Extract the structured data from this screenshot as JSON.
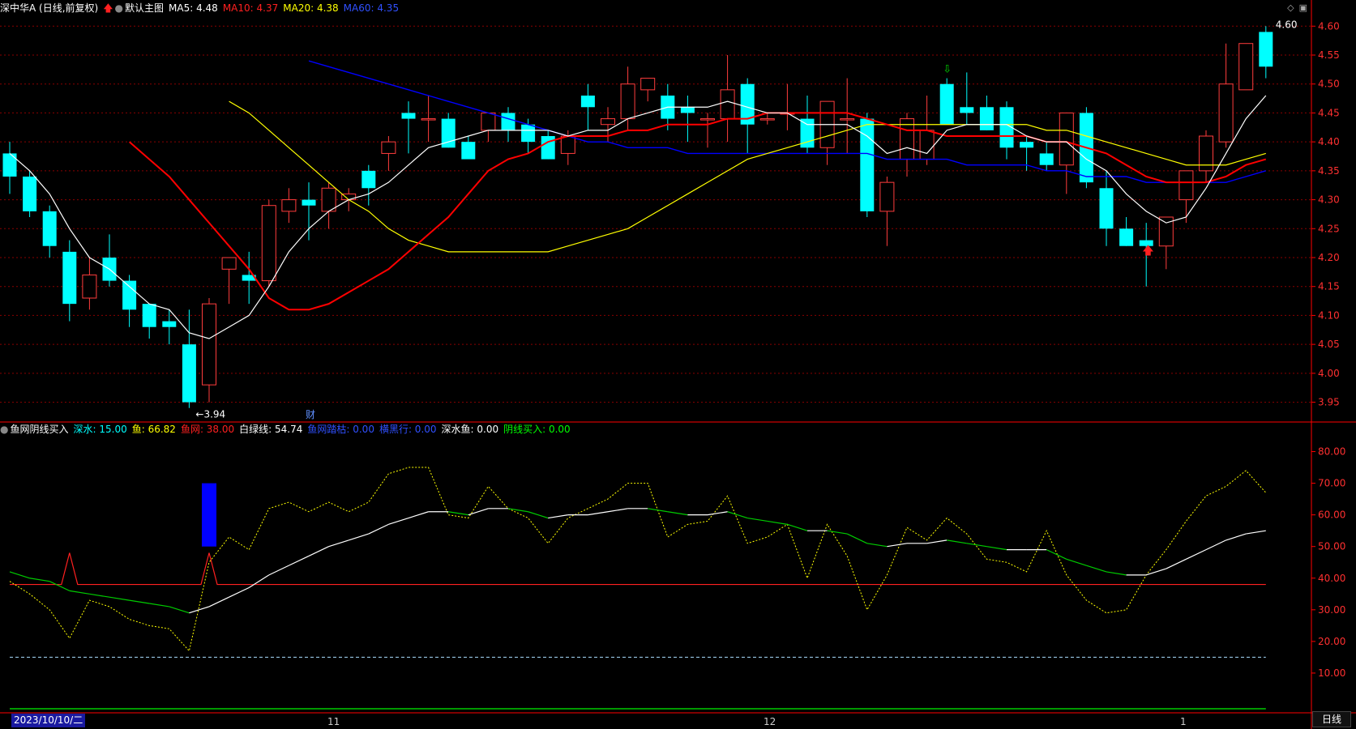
{
  "main_header": {
    "stock": "深中华A (日线,前复权)",
    "template": "默认主图",
    "ma5": "MA5: 4.48",
    "ma10": "MA10: 4.37",
    "ma20": "MA20: 4.38",
    "ma60": "MA60: 4.35"
  },
  "sub_header": {
    "name": "鱼网阴线买入",
    "deep_water": "深水: 15.00",
    "fish": "鱼: 66.82",
    "net": "鱼网: 38.00",
    "white_line": "白绿线: 54.74",
    "net_fish": "鱼网踏枯: 0.00",
    "mark_line": "横黑行: 0.00",
    "deep_fish": "深水鱼: 0.00",
    "yin_buy": "阴线买入: 0.00"
  },
  "colors": {
    "up": "#ff3c3c",
    "down": "#00ffff",
    "ma5": "#ffffff",
    "ma10": "#ff0000",
    "ma20": "#ffff00",
    "ma60": "#0000ff",
    "grid": "#8a0000",
    "axis": "#ff0000"
  },
  "price_axis": [
    "4.60",
    "4.55",
    "4.50",
    "4.45",
    "4.40",
    "4.35",
    "4.30",
    "4.25",
    "4.20",
    "4.15",
    "4.10",
    "4.05",
    "4.00",
    "3.95"
  ],
  "sub_axis": [
    "80.00",
    "70.00",
    "60.00",
    "50.00",
    "40.00",
    "30.00",
    "20.00",
    "10.00"
  ],
  "annotations": {
    "high": "4.60",
    "low": "3.94",
    "fin_marker": "财"
  },
  "x_axis": {
    "date": "2023/10/10/二",
    "nov": "11",
    "dec": "12",
    "jan": "1"
  },
  "period_tab": "日线",
  "chart_data": {
    "type": "candlestick",
    "ylim": [
      3.92,
      4.62
    ],
    "candles": [
      [
        4.38,
        4.4,
        4.31,
        4.34
      ],
      [
        4.34,
        4.35,
        4.27,
        4.28
      ],
      [
        4.28,
        4.29,
        4.2,
        4.22
      ],
      [
        4.21,
        4.23,
        4.09,
        4.12
      ],
      [
        4.13,
        4.2,
        4.11,
        4.17
      ],
      [
        4.2,
        4.24,
        4.15,
        4.16
      ],
      [
        4.16,
        4.17,
        4.08,
        4.11
      ],
      [
        4.12,
        4.12,
        4.06,
        4.08
      ],
      [
        4.09,
        4.11,
        4.05,
        4.08
      ],
      [
        4.05,
        4.11,
        3.94,
        3.95
      ],
      [
        3.98,
        4.13,
        3.95,
        4.12
      ],
      [
        4.18,
        4.2,
        4.12,
        4.2
      ],
      [
        4.17,
        4.21,
        4.12,
        4.16
      ],
      [
        4.16,
        4.3,
        4.15,
        4.29
      ],
      [
        4.28,
        4.32,
        4.26,
        4.3
      ],
      [
        4.3,
        4.33,
        4.23,
        4.29
      ],
      [
        4.28,
        4.33,
        4.25,
        4.32
      ],
      [
        4.3,
        4.32,
        4.28,
        4.31
      ],
      [
        4.35,
        4.36,
        4.29,
        4.32
      ],
      [
        4.38,
        4.41,
        4.35,
        4.4
      ],
      [
        4.45,
        4.47,
        4.38,
        4.44
      ],
      [
        4.44,
        4.48,
        4.4,
        4.44
      ],
      [
        4.44,
        4.45,
        4.39,
        4.39
      ],
      [
        4.4,
        4.41,
        4.38,
        4.37
      ],
      [
        4.42,
        4.45,
        4.4,
        4.45
      ],
      [
        4.45,
        4.46,
        4.4,
        4.42
      ],
      [
        4.43,
        4.44,
        4.38,
        4.4
      ],
      [
        4.41,
        4.42,
        4.37,
        4.37
      ],
      [
        4.38,
        4.42,
        4.36,
        4.41
      ],
      [
        4.48,
        4.5,
        4.42,
        4.46
      ],
      [
        4.43,
        4.46,
        4.4,
        4.44
      ],
      [
        4.44,
        4.53,
        4.42,
        4.5
      ],
      [
        4.49,
        4.51,
        4.47,
        4.51
      ],
      [
        4.48,
        4.5,
        4.42,
        4.44
      ],
      [
        4.46,
        4.48,
        4.4,
        4.45
      ],
      [
        4.44,
        4.45,
        4.39,
        4.44
      ],
      [
        4.44,
        4.55,
        4.4,
        4.49
      ],
      [
        4.5,
        4.51,
        4.38,
        4.43
      ],
      [
        4.44,
        4.45,
        4.43,
        4.44
      ],
      [
        4.45,
        4.5,
        4.42,
        4.45
      ],
      [
        4.44,
        4.48,
        4.38,
        4.39
      ],
      [
        4.39,
        4.47,
        4.36,
        4.47
      ],
      [
        4.44,
        4.51,
        4.38,
        4.44
      ],
      [
        4.44,
        4.45,
        4.27,
        4.28
      ],
      [
        4.28,
        4.34,
        4.22,
        4.33
      ],
      [
        4.37,
        4.45,
        4.34,
        4.44
      ],
      [
        4.37,
        4.48,
        4.36,
        4.42
      ],
      [
        4.5,
        4.51,
        4.43,
        4.43
      ],
      [
        4.46,
        4.52,
        4.43,
        4.45
      ],
      [
        4.46,
        4.48,
        4.42,
        4.42
      ],
      [
        4.46,
        4.47,
        4.37,
        4.39
      ],
      [
        4.4,
        4.41,
        4.35,
        4.39
      ],
      [
        4.38,
        4.4,
        4.35,
        4.36
      ],
      [
        4.36,
        4.45,
        4.31,
        4.45
      ],
      [
        4.45,
        4.46,
        4.32,
        4.33
      ],
      [
        4.32,
        4.35,
        4.22,
        4.25
      ],
      [
        4.25,
        4.27,
        4.22,
        4.22
      ],
      [
        4.23,
        4.26,
        4.15,
        4.22
      ],
      [
        4.22,
        4.27,
        4.18,
        4.27
      ],
      [
        4.3,
        4.35,
        4.26,
        4.35
      ],
      [
        4.35,
        4.42,
        4.33,
        4.41
      ],
      [
        4.4,
        4.57,
        4.39,
        4.5
      ],
      [
        4.49,
        4.57,
        4.49,
        4.57
      ],
      [
        4.59,
        4.6,
        4.51,
        4.53
      ]
    ],
    "ma5": [
      4.38,
      4.35,
      4.31,
      4.25,
      4.2,
      4.18,
      4.15,
      4.12,
      4.11,
      4.07,
      4.06,
      4.08,
      4.1,
      4.15,
      4.21,
      4.25,
      4.28,
      4.3,
      4.31,
      4.33,
      4.36,
      4.39,
      4.4,
      4.41,
      4.42,
      4.42,
      4.42,
      4.42,
      4.41,
      4.42,
      4.42,
      4.44,
      4.45,
      4.46,
      4.46,
      4.46,
      4.47,
      4.46,
      4.45,
      4.45,
      4.43,
      4.43,
      4.43,
      4.41,
      4.38,
      4.39,
      4.38,
      4.42,
      4.43,
      4.43,
      4.43,
      4.41,
      4.4,
      4.4,
      4.37,
      4.35,
      4.31,
      4.28,
      4.26,
      4.27,
      4.32,
      4.38,
      4.44,
      4.48
    ],
    "ma10": [
      4.4,
      4.37,
      4.34,
      4.3,
      4.26,
      4.22,
      4.18,
      4.13,
      4.11,
      4.11,
      4.12,
      4.14,
      4.16,
      4.18,
      4.21,
      4.24,
      4.27,
      4.31,
      4.35,
      4.37,
      4.38,
      4.4,
      4.41,
      4.41,
      4.41,
      4.42,
      4.42,
      4.43,
      4.43,
      4.43,
      4.44,
      4.44,
      4.45,
      4.45,
      4.45,
      4.45,
      4.45,
      4.44,
      4.43,
      4.42,
      4.42,
      4.41,
      4.41,
      4.41,
      4.41,
      4.41,
      4.4,
      4.4,
      4.39,
      4.38,
      4.36,
      4.34,
      4.33,
      4.33,
      4.33,
      4.34,
      4.36,
      4.37
    ],
    "ma20": [
      4.47,
      4.45,
      4.42,
      4.39,
      4.36,
      4.33,
      4.3,
      4.28,
      4.25,
      4.23,
      4.22,
      4.21,
      4.21,
      4.21,
      4.21,
      4.21,
      4.21,
      4.22,
      4.23,
      4.24,
      4.25,
      4.27,
      4.29,
      4.31,
      4.33,
      4.35,
      4.37,
      4.38,
      4.39,
      4.4,
      4.41,
      4.42,
      4.43,
      4.43,
      4.43,
      4.43,
      4.43,
      4.43,
      4.43,
      4.43,
      4.43,
      4.42,
      4.42,
      4.41,
      4.4,
      4.39,
      4.38,
      4.37,
      4.36,
      4.36,
      4.36,
      4.37,
      4.38
    ],
    "ma60": [
      4.54,
      4.53,
      4.52,
      4.51,
      4.5,
      4.49,
      4.48,
      4.47,
      4.46,
      4.45,
      4.44,
      4.43,
      4.42,
      4.41,
      4.4,
      4.4,
      4.39,
      4.39,
      4.39,
      4.38,
      4.38,
      4.38,
      4.38,
      4.38,
      4.38,
      4.38,
      4.38,
      4.38,
      4.38,
      4.37,
      4.37,
      4.37,
      4.37,
      4.36,
      4.36,
      4.36,
      4.36,
      4.35,
      4.35,
      4.34,
      4.34,
      4.34,
      4.33,
      4.33,
      4.33,
      4.33,
      4.33,
      4.34,
      4.35
    ],
    "sub": {
      "ylim": [
        0,
        85
      ],
      "net_level": 38,
      "deep_water_level": 15,
      "fish": [
        39,
        35,
        30,
        21,
        33,
        31,
        27,
        25,
        24,
        17,
        45,
        53,
        49,
        62,
        64,
        61,
        64,
        61,
        64,
        73,
        75,
        75,
        60,
        59,
        69,
        62,
        59,
        51,
        59,
        62,
        65,
        70,
        70,
        53,
        57,
        58,
        66,
        51,
        53,
        57,
        40,
        57,
        47,
        30,
        41,
        56,
        52,
        59,
        54,
        46,
        45,
        42,
        55,
        41,
        33,
        29,
        30,
        41,
        49,
        58,
        66,
        69,
        74,
        67
      ],
      "white": [
        42,
        40,
        39,
        36,
        35,
        34,
        33,
        32,
        31,
        29,
        31,
        34,
        37,
        41,
        44,
        47,
        50,
        52,
        54,
        57,
        59,
        61,
        61,
        60,
        62,
        62,
        61,
        59,
        60,
        60,
        61,
        62,
        62,
        61,
        60,
        60,
        61,
        59,
        58,
        57,
        55,
        55,
        54,
        51,
        50,
        51,
        51,
        52,
        51,
        50,
        49,
        49,
        49,
        46,
        44,
        42,
        41,
        41,
        43,
        46,
        49,
        52,
        54,
        55
      ],
      "spike_index": 10,
      "blue_bar": [
        50,
        70
      ],
      "blue_bar_index": 10
    }
  }
}
